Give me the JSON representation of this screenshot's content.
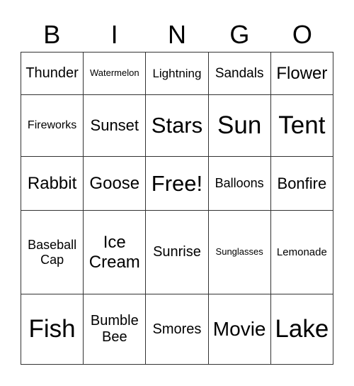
{
  "title_letters": [
    "B",
    "I",
    "N",
    "G",
    "O"
  ],
  "cells": [
    [
      {
        "text": "Thunder",
        "size": 20
      },
      {
        "text": "Watermelon",
        "size": 13
      },
      {
        "text": "Lightning",
        "size": 17
      },
      {
        "text": "Sandals",
        "size": 19
      },
      {
        "text": "Flower",
        "size": 24
      }
    ],
    [
      {
        "text": "Fireworks",
        "size": 16
      },
      {
        "text": "Sunset",
        "size": 22
      },
      {
        "text": "Stars",
        "size": 31
      },
      {
        "text": "Sun",
        "size": 35
      },
      {
        "text": "Tent",
        "size": 35
      }
    ],
    [
      {
        "text": "Rabbit",
        "size": 24
      },
      {
        "text": "Goose",
        "size": 24
      },
      {
        "text": "Free!",
        "size": 31
      },
      {
        "text": "Balloons",
        "size": 18
      },
      {
        "text": "Bonfire",
        "size": 22
      }
    ],
    [
      {
        "text": "Baseball Cap",
        "size": 18
      },
      {
        "text": "Ice Cream",
        "size": 24
      },
      {
        "text": "Sunrise",
        "size": 20
      },
      {
        "text": "Sunglasses",
        "size": 13
      },
      {
        "text": "Lemonade",
        "size": 15
      }
    ],
    [
      {
        "text": "Fish",
        "size": 35
      },
      {
        "text": "Bumble Bee",
        "size": 20
      },
      {
        "text": "Smores",
        "size": 20
      },
      {
        "text": "Movie",
        "size": 28
      },
      {
        "text": "Lake",
        "size": 35
      }
    ]
  ]
}
